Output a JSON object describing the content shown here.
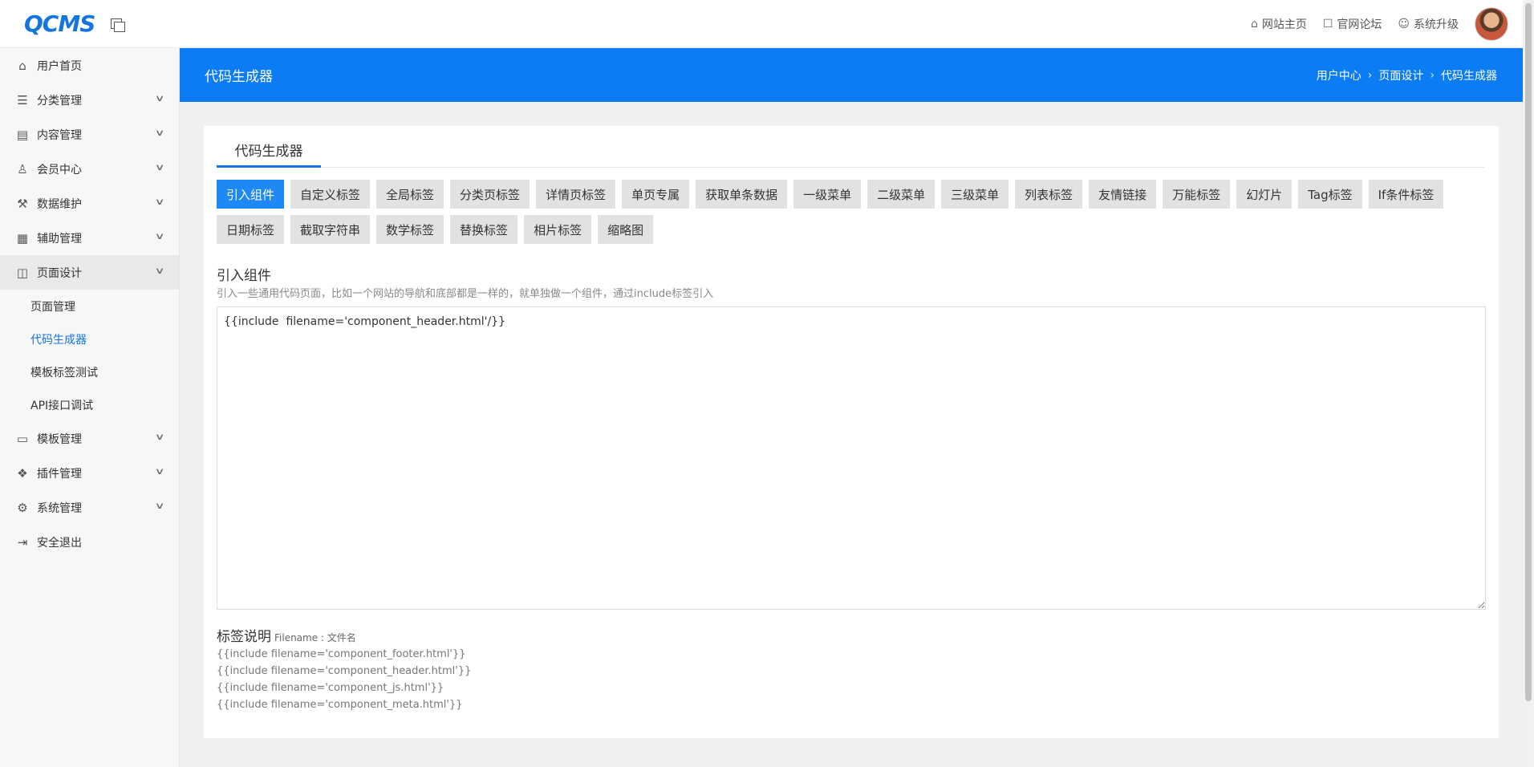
{
  "brand": {
    "logo": "QCMS"
  },
  "top_links": [
    {
      "icon": "home-icon",
      "glyph": "⌂",
      "label": "网站主页"
    },
    {
      "icon": "forum-icon",
      "glyph": "☐",
      "label": "官网论坛"
    },
    {
      "icon": "smile-icon",
      "glyph": "☺",
      "label": "系统升级"
    }
  ],
  "sidebar": {
    "items": [
      {
        "label": "用户首页",
        "icon": "home-icon",
        "glyph": "⌂",
        "expandable": false
      },
      {
        "label": "分类管理",
        "icon": "list-icon",
        "glyph": "☰",
        "expandable": true
      },
      {
        "label": "内容管理",
        "icon": "document-icon",
        "glyph": "▤",
        "expandable": true
      },
      {
        "label": "会员中心",
        "icon": "user-icon",
        "glyph": "♙",
        "expandable": true
      },
      {
        "label": "数据维护",
        "icon": "wrench-icon",
        "glyph": "⚒",
        "expandable": true
      },
      {
        "label": "辅助管理",
        "icon": "grid-icon",
        "glyph": "▦",
        "expandable": true
      },
      {
        "label": "页面设计",
        "icon": "layout-icon",
        "glyph": "◫",
        "expandable": true,
        "open": true
      },
      {
        "label": "模板管理",
        "icon": "window-icon",
        "glyph": "▭",
        "expandable": true
      },
      {
        "label": "插件管理",
        "icon": "plugin-icon",
        "glyph": "❖",
        "expandable": true
      },
      {
        "label": "系统管理",
        "icon": "gear-icon",
        "glyph": "⚙",
        "expandable": true
      },
      {
        "label": "安全退出",
        "icon": "logout-icon",
        "glyph": "⇥",
        "expandable": false
      }
    ],
    "sub_items": [
      {
        "label": "页面管理"
      },
      {
        "label": "代码生成器",
        "active": true
      },
      {
        "label": "模板标签测试"
      },
      {
        "label": "API接口调试"
      }
    ]
  },
  "header": {
    "title": "代码生成器",
    "breadcrumb": [
      "用户中心",
      "页面设计",
      "代码生成器"
    ]
  },
  "card": {
    "tab": "代码生成器",
    "buttons": [
      "引入组件",
      "自定义标签",
      "全局标签",
      "分类页标签",
      "详情页标签",
      "单页专属",
      "获取单条数据",
      "一级菜单",
      "二级菜单",
      "三级菜单",
      "列表标签",
      "友情链接",
      "万能标签",
      "幻灯片",
      "Tag标签",
      "If条件标签",
      "日期标签",
      "截取字符串",
      "数学标签",
      "替换标签",
      "相片标签",
      "缩略图"
    ],
    "active_button": 0,
    "section_title": "引入组件",
    "section_desc": "引入一些通用代码页面，比如一个网站的导航和底部都是一样的，就单独做一个组件，通过include标签引入",
    "code": "{{include  filename='component_header.html'/}}",
    "explain_title": "标签说明",
    "explain_sub": "Filename : 文件名",
    "examples": [
      "{{include filename='component_footer.html'}}",
      "{{include filename='component_header.html'}}",
      "{{include filename='component_js.html'}}",
      "{{include filename='component_meta.html'}}"
    ]
  },
  "colors": {
    "primary": "#0b7cf4",
    "active_text": "#1475e0",
    "button_bg": "#e2e2e2"
  }
}
